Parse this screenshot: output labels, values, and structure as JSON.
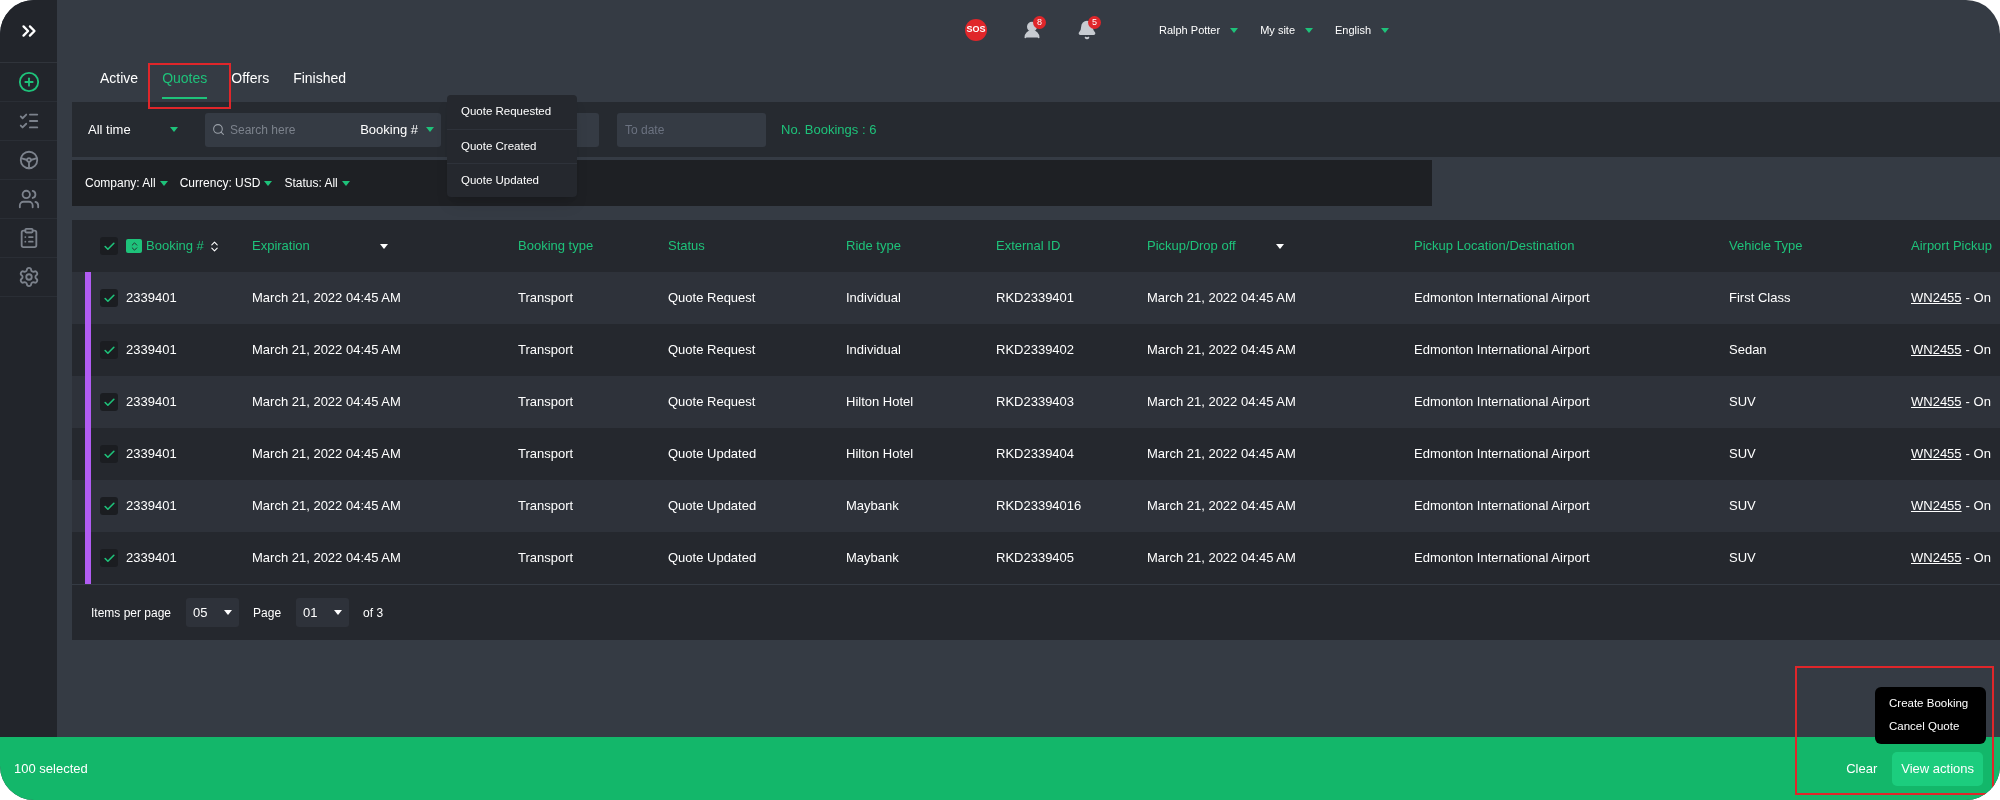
{
  "header": {
    "sos": "SOS",
    "contacts_badge": "8",
    "notifications_badge": "5",
    "menus": [
      {
        "label": "Ralph Potter"
      },
      {
        "label": "My site"
      },
      {
        "label": "English"
      }
    ]
  },
  "tabs": [
    {
      "label": "Active",
      "selected": false
    },
    {
      "label": "Quotes",
      "selected": true
    },
    {
      "label": "Offers",
      "selected": false
    },
    {
      "label": "Finished",
      "selected": false
    }
  ],
  "filters": {
    "period": "All time",
    "search": {
      "placeholder": "Search here",
      "field": "Booking #"
    },
    "to_date": {
      "placeholder": "To date"
    },
    "count": "No. Bookings : 6"
  },
  "status_menu": [
    "Quote Requested",
    "Quote Created",
    "Quote Updated"
  ],
  "chips": [
    "Company: All",
    "Currency: USD",
    "Status: All"
  ],
  "table": {
    "all_checked": true,
    "columns": [
      {
        "label": "Booking #",
        "sortable": true,
        "icon": true
      },
      {
        "label": "Expiration",
        "dropdown": true
      },
      {
        "label": "Booking type"
      },
      {
        "label": "Status"
      },
      {
        "label": "Ride type"
      },
      {
        "label": "External ID"
      },
      {
        "label": "Pickup/Drop off",
        "dropdown": true
      },
      {
        "label": "Pickup Location/Destination"
      },
      {
        "label": "Vehicle Type"
      },
      {
        "label": "Airport Pickup"
      }
    ],
    "rows": [
      {
        "selected": true,
        "checked": true,
        "cells": [
          "2339401",
          "March 21, 2022 04:45 AM",
          "Transport",
          "Quote Request",
          "Individual",
          "RKD2339401",
          "March 21, 2022 04:45 AM",
          "Edmonton International Airport",
          "First Class"
        ],
        "flight": "WN2455",
        "flight_status": "- On"
      },
      {
        "selected": true,
        "checked": true,
        "cells": [
          "2339401",
          "March 21, 2022 04:45 AM",
          "Transport",
          "Quote Request",
          "Individual",
          "RKD2339402",
          "March 21, 2022 04:45 AM",
          "Edmonton International Airport",
          "Sedan"
        ],
        "flight": "WN2455",
        "flight_status": "- On"
      },
      {
        "selected": true,
        "checked": true,
        "cells": [
          "2339401",
          "March 21, 2022 04:45 AM",
          "Transport",
          "Quote Request",
          "Hilton Hotel",
          "RKD2339403",
          "March 21, 2022 04:45 AM",
          "Edmonton International Airport",
          "SUV"
        ],
        "flight": "WN2455",
        "flight_status": "- On"
      },
      {
        "selected": true,
        "checked": true,
        "cells": [
          "2339401",
          "March 21, 2022 04:45 AM",
          "Transport",
          "Quote Updated",
          "Hilton Hotel",
          "RKD2339404",
          "March 21, 2022 04:45 AM",
          "Edmonton International Airport",
          "SUV"
        ],
        "flight": "WN2455",
        "flight_status": "- On"
      },
      {
        "selected": true,
        "checked": true,
        "cells": [
          "2339401",
          "March 21, 2022 04:45 AM",
          "Transport",
          "Quote Updated",
          "Maybank",
          "RKD23394016",
          "March 21, 2022 04:45 AM",
          "Edmonton International Airport",
          "SUV"
        ],
        "flight": "WN2455",
        "flight_status": "- On"
      },
      {
        "selected": true,
        "checked": true,
        "cells": [
          "2339401",
          "March 21, 2022 04:45 AM",
          "Transport",
          "Quote Updated",
          "Maybank",
          "RKD2339405",
          "March 21, 2022 04:45 AM",
          "Edmonton International Airport",
          "SUV"
        ],
        "flight": "WN2455",
        "flight_status": "- On"
      }
    ]
  },
  "pagination": {
    "items_label": "Items per page",
    "per_page": "05",
    "page_label": "Page",
    "page": "01",
    "of": "of 3"
  },
  "selection_bar": {
    "count": "100 selected",
    "clear": "Clear",
    "actions": "View actions",
    "menu": [
      "Create Booking",
      "Cancel Quote"
    ]
  }
}
